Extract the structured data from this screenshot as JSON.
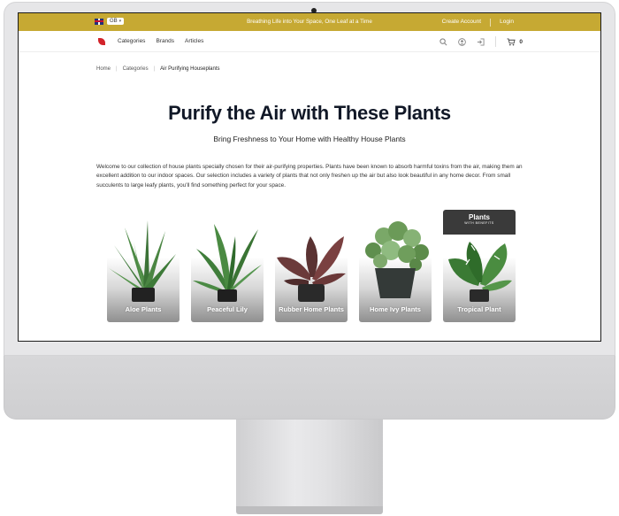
{
  "topbar": {
    "lang": "GB",
    "tagline": "Breathing Life into Your Space, One Leaf at a Time",
    "create_account": "Create Account",
    "login": "Login"
  },
  "nav": {
    "links": [
      "Categories",
      "Brands",
      "Articles"
    ],
    "cart_count": "0"
  },
  "breadcrumb": {
    "home": "Home",
    "categories": "Categories",
    "current": "Air Purifying Houseplants"
  },
  "hero": {
    "title": "Purify the Air with These Plants",
    "subtitle": "Bring Freshness to Your Home with Healthy House Plants",
    "intro": "Welcome to our collection of house plants specially chosen for their air-purifying properties. Plants have been known to absorb harmful toxins from the air, making them an excellent addition to our indoor spaces. Our selection includes a variety of plants that not only freshen up the air but also look beautiful in any home decor. From small succulents to large leafy plants, you'll find something perfect for your space."
  },
  "cards": [
    {
      "label": "Aloe Plants"
    },
    {
      "label": "Peaceful Lily"
    },
    {
      "label": "Rubber Home Plants"
    },
    {
      "label": "Home Ivy Plants"
    },
    {
      "label": "Tropical Plant",
      "badge": "Plants",
      "badge_sub": "WITH BENEFITS"
    }
  ],
  "colors": {
    "topbar": "#c6a933",
    "logo": "#d2232a",
    "title": "#111827"
  }
}
